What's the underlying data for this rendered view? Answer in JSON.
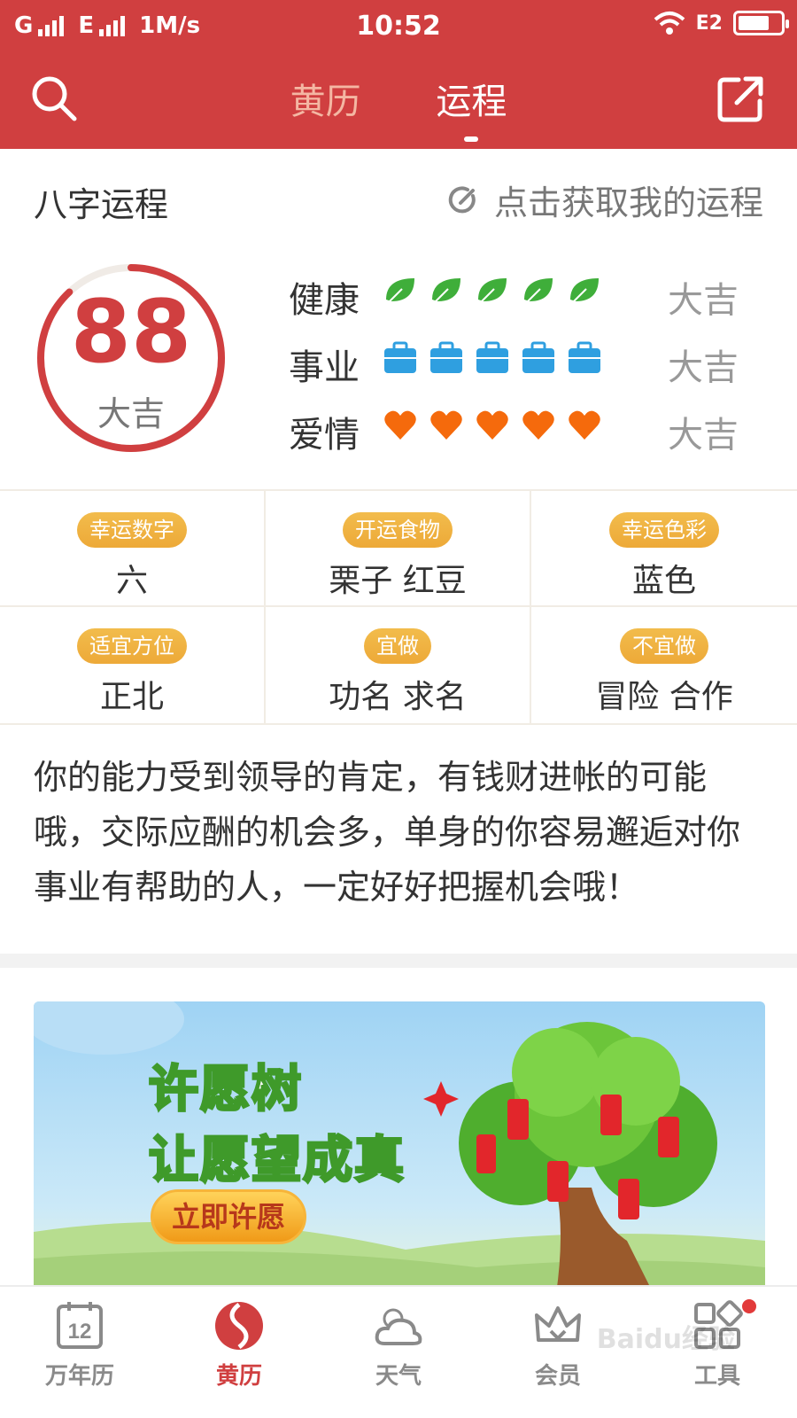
{
  "status_bar": {
    "network1": "G",
    "network2": "E",
    "speed": "1M/s",
    "time": "10:52",
    "sim_label": "E2"
  },
  "header": {
    "tabs": [
      {
        "label": "黄历",
        "active": false
      },
      {
        "label": "运程",
        "active": true
      }
    ],
    "search_icon": "search-icon",
    "share_icon": "share-icon"
  },
  "bazi": {
    "title": "八字运程",
    "link_label": "点击获取我的运程",
    "score": "88",
    "score_label": "大吉",
    "score_fraction": 0.88,
    "rows": [
      {
        "name": "健康",
        "icon": "leaf-icon",
        "count": 5,
        "rating": "大吉",
        "color": "#3fae3a"
      },
      {
        "name": "事业",
        "icon": "briefcase-icon",
        "count": 5,
        "rating": "大吉",
        "color": "#2f9fe0"
      },
      {
        "name": "爱情",
        "icon": "heart-icon",
        "count": 5,
        "rating": "大吉",
        "color": "#f56a0c"
      }
    ]
  },
  "grid": [
    {
      "tag": "幸运数字",
      "value": "六"
    },
    {
      "tag": "开运食物",
      "value": "栗子 红豆"
    },
    {
      "tag": "幸运色彩",
      "value": "蓝色"
    },
    {
      "tag": "适宜方位",
      "value": "正北"
    },
    {
      "tag": "宜做",
      "value": "功名 求名"
    },
    {
      "tag": "不宜做",
      "value": "冒险 合作"
    }
  ],
  "description": "你的能力受到领导的肯定，有钱财进帐的可能哦，交际应酬的机会多，单身的你容易邂逅对你事业有帮助的人，一定好好把握机会哦！",
  "banner": {
    "line1": "许愿树",
    "line2": "让愿望成真",
    "button": "立即许愿"
  },
  "bottom_nav": [
    {
      "label": "万年历",
      "icon": "calendar-icon",
      "badge": "12",
      "active": false
    },
    {
      "label": "黄历",
      "icon": "almanac-icon",
      "active": true
    },
    {
      "label": "天气",
      "icon": "weather-icon",
      "active": false
    },
    {
      "label": "会员",
      "icon": "crown-icon",
      "active": false
    },
    {
      "label": "工具",
      "icon": "tools-icon",
      "active": false
    }
  ],
  "watermark": "Baidu经验",
  "colors": {
    "brand": "#d03f40",
    "tag": "#eda938"
  }
}
